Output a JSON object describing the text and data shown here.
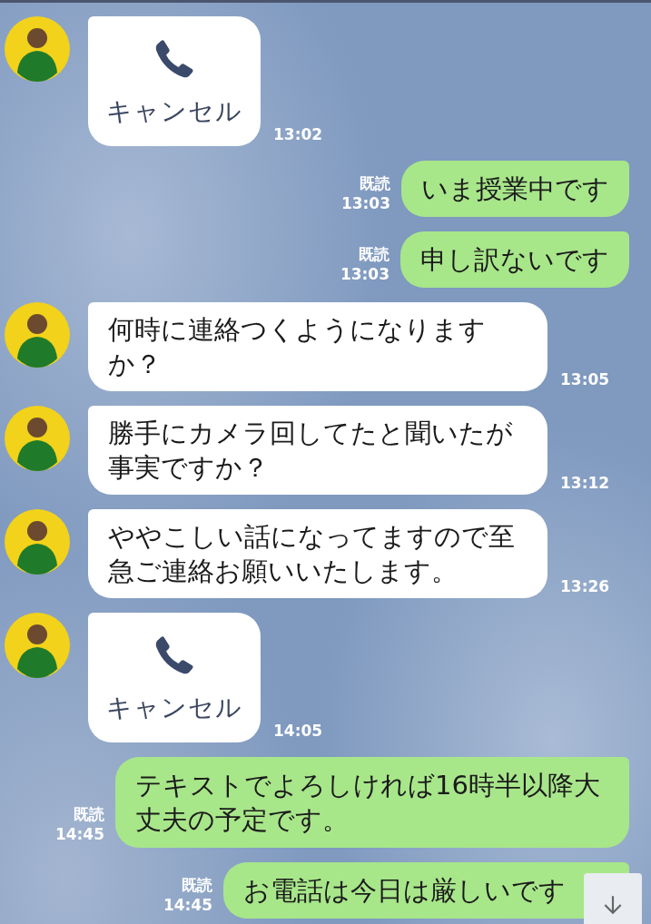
{
  "messages": [
    {
      "kind": "call",
      "mine": false,
      "text": "キャンセル",
      "time": "13:02"
    },
    {
      "kind": "text",
      "mine": true,
      "text": "いま授業中です",
      "read": "既読",
      "time": "13:03"
    },
    {
      "kind": "text",
      "mine": true,
      "text": "申し訳ないです",
      "read": "既読",
      "time": "13:03"
    },
    {
      "kind": "text",
      "mine": false,
      "text": "何時に連絡つくようになりますか？",
      "time": "13:05"
    },
    {
      "kind": "text",
      "mine": false,
      "text": "勝手にカメラ回してたと聞いたが事実ですか？",
      "time": "13:12"
    },
    {
      "kind": "text",
      "mine": false,
      "text": "ややこしい話になってますので至急ご連絡お願いいたします。",
      "time": "13:26"
    },
    {
      "kind": "call",
      "mine": false,
      "text": "キャンセル",
      "time": "14:05"
    },
    {
      "kind": "text",
      "mine": true,
      "text": "テキストでよろしければ16時半以降大丈夫の予定です。",
      "read": "既読",
      "time": "14:45"
    },
    {
      "kind": "text",
      "mine": true,
      "text": "お電話は今日は厳しいです",
      "read": "既読",
      "time": "14:45"
    }
  ]
}
